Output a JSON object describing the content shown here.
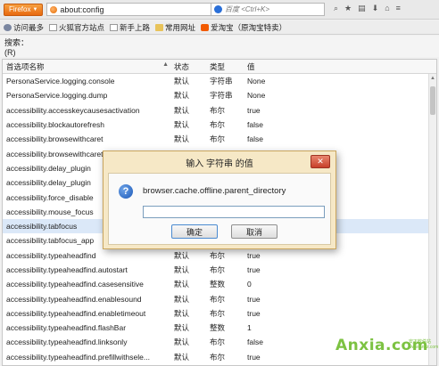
{
  "navbar": {
    "firefox_label": "Firefox",
    "url": "about:config",
    "search_placeholder": "百度 <Ctrl+K>"
  },
  "bookmarks": [
    {
      "label": "访问最多",
      "icon": "gear-icon"
    },
    {
      "label": "火狐官方站点",
      "icon": "page-icon"
    },
    {
      "label": "新手上路",
      "icon": "page-icon"
    },
    {
      "label": "常用网址",
      "icon": "folder-icon"
    },
    {
      "label": "爱淘宝（原淘宝特卖）",
      "icon": "taobao-icon"
    }
  ],
  "filter": {
    "label": "搜索：(R)",
    "value": ""
  },
  "table": {
    "headers": {
      "name": "首选项名称",
      "status": "状态",
      "type": "类型",
      "value": "值"
    },
    "rows": [
      {
        "name": "PersonaService.logging.console",
        "status": "默认",
        "type": "字符串",
        "value": "None"
      },
      {
        "name": "PersonaService.logging.dump",
        "status": "默认",
        "type": "字符串",
        "value": "None"
      },
      {
        "name": "accessibility.accesskeycausesactivation",
        "status": "默认",
        "type": "布尔",
        "value": "true"
      },
      {
        "name": "accessibility.blockautorefresh",
        "status": "默认",
        "type": "布尔",
        "value": "false"
      },
      {
        "name": "accessibility.browsewithcaret",
        "status": "默认",
        "type": "布尔",
        "value": "false"
      },
      {
        "name": "accessibility.browsewithcaret_",
        "status": "",
        "type": "",
        "value": ""
      },
      {
        "name": "accessibility.delay_plugin",
        "status": "",
        "type": "",
        "value": ""
      },
      {
        "name": "accessibility.delay_plugin",
        "status": "",
        "type": "",
        "value": ""
      },
      {
        "name": "accessibility.force_disable",
        "status": "",
        "type": "",
        "value": ""
      },
      {
        "name": "accessibility.mouse_focus",
        "status": "",
        "type": "",
        "value": ""
      },
      {
        "name": "accessibility.tabfocus",
        "status": "",
        "type": "",
        "value": ""
      },
      {
        "name": "accessibility.tabfocus_app",
        "status": "",
        "type": "",
        "value": ""
      },
      {
        "name": "accessibility.typeaheadfind",
        "status": "默认",
        "type": "布尔",
        "value": "true"
      },
      {
        "name": "accessibility.typeaheadfind.autostart",
        "status": "默认",
        "type": "布尔",
        "value": "true"
      },
      {
        "name": "accessibility.typeaheadfind.casesensitive",
        "status": "默认",
        "type": "整数",
        "value": "0"
      },
      {
        "name": "accessibility.typeaheadfind.enablesound",
        "status": "默认",
        "type": "布尔",
        "value": "true"
      },
      {
        "name": "accessibility.typeaheadfind.enabletimeout",
        "status": "默认",
        "type": "布尔",
        "value": "true"
      },
      {
        "name": "accessibility.typeaheadfind.flashBar",
        "status": "默认",
        "type": "整数",
        "value": "1"
      },
      {
        "name": "accessibility.typeaheadfind.linksonly",
        "status": "默认",
        "type": "布尔",
        "value": "false"
      },
      {
        "name": "accessibility.typeaheadfind.prefillwithsele...",
        "status": "默认",
        "type": "布尔",
        "value": "true"
      },
      {
        "name": "accessibility.typeaheadfind.soundURL",
        "status": "默认",
        "type": "字符串",
        "value": "beep"
      }
    ]
  },
  "dialog": {
    "title": "输入 字符串 的值",
    "message": "browser.cache.offline.parent_directory",
    "input_value": "",
    "ok_label": "确定",
    "cancel_label": "取消",
    "close_glyph": "✕"
  },
  "watermark": {
    "text": "Anxia.com",
    "sub_line1": "安下软件站",
    "sub_line2": "www.anxz.com"
  },
  "colors": {
    "firefox_orange": "#e86a10",
    "dialog_bg": "#f6e8c6",
    "close_red": "#c7402a",
    "watermark_green": "#7cc242"
  }
}
